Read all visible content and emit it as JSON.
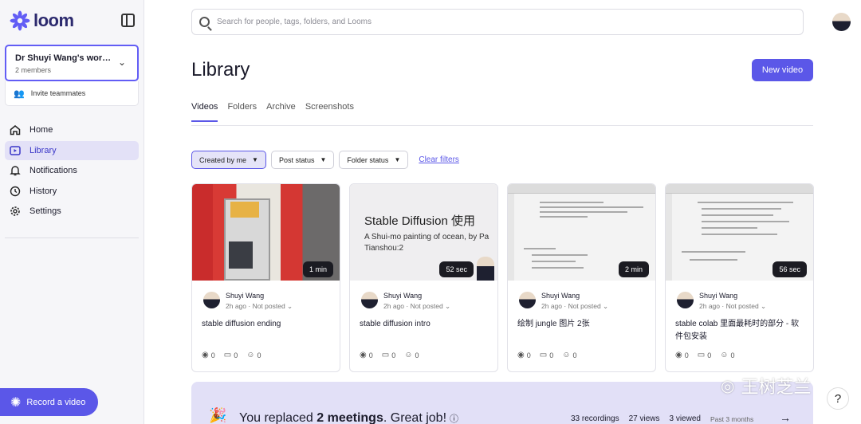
{
  "app": {
    "brand": "loom",
    "accent": "#5b57e8"
  },
  "workspace": {
    "name": "Dr Shuyi Wang's works...",
    "members": "2 members",
    "invite": "Invite teammates"
  },
  "sidebar": {
    "items": [
      {
        "label": "Home",
        "icon": "home-icon"
      },
      {
        "label": "Library",
        "icon": "library-icon",
        "active": true
      },
      {
        "label": "Notifications",
        "icon": "bell-icon"
      },
      {
        "label": "History",
        "icon": "clock-icon"
      },
      {
        "label": "Settings",
        "icon": "gear-icon"
      }
    ],
    "record": "Record a video"
  },
  "search": {
    "placeholder": "Search for people, tags, folders, and Looms"
  },
  "page": {
    "title": "Library",
    "new_video": "New video"
  },
  "tabs": [
    "Videos",
    "Folders",
    "Archive",
    "Screenshots"
  ],
  "filters": {
    "created": "Created by me",
    "post": "Post status",
    "folder": "Folder status",
    "clear": "Clear filters"
  },
  "cards": [
    {
      "duration": "1 min",
      "author": "Shuyi Wang",
      "time": "2h ago",
      "status": "Not posted",
      "title": "stable diffusion ending",
      "views": "0",
      "comments": "0",
      "reactions": "0"
    },
    {
      "duration": "52 sec",
      "author": "Shuyi Wang",
      "time": "2h ago",
      "status": "Not posted",
      "title": "stable diffusion intro",
      "views": "0",
      "comments": "0",
      "reactions": "0",
      "thumb_title": "Stable Diffusion 使用",
      "thumb_sub1": "A Shui-mo painting of ocean, by Pa",
      "thumb_sub2": "Tianshou:2"
    },
    {
      "duration": "2 min",
      "author": "Shuyi Wang",
      "time": "2h ago",
      "status": "Not posted",
      "title": "绘制 jungle 图片 2张",
      "views": "0",
      "comments": "0",
      "reactions": "0"
    },
    {
      "duration": "56 sec",
      "author": "Shuyi Wang",
      "time": "2h ago",
      "status": "Not posted",
      "title": "stable colab 里面最耗时的部分 - 软件包安装",
      "views": "0",
      "comments": "0",
      "reactions": "0"
    }
  ],
  "banner": {
    "prefix": "You replaced ",
    "bold": "2 meetings",
    "suffix": ". Great job!",
    "recordings": "33 recordings",
    "views": "27 views",
    "viewed": "3 viewed",
    "period": "Past 3 months"
  },
  "watermark": "王树芝兰",
  "help": "?"
}
